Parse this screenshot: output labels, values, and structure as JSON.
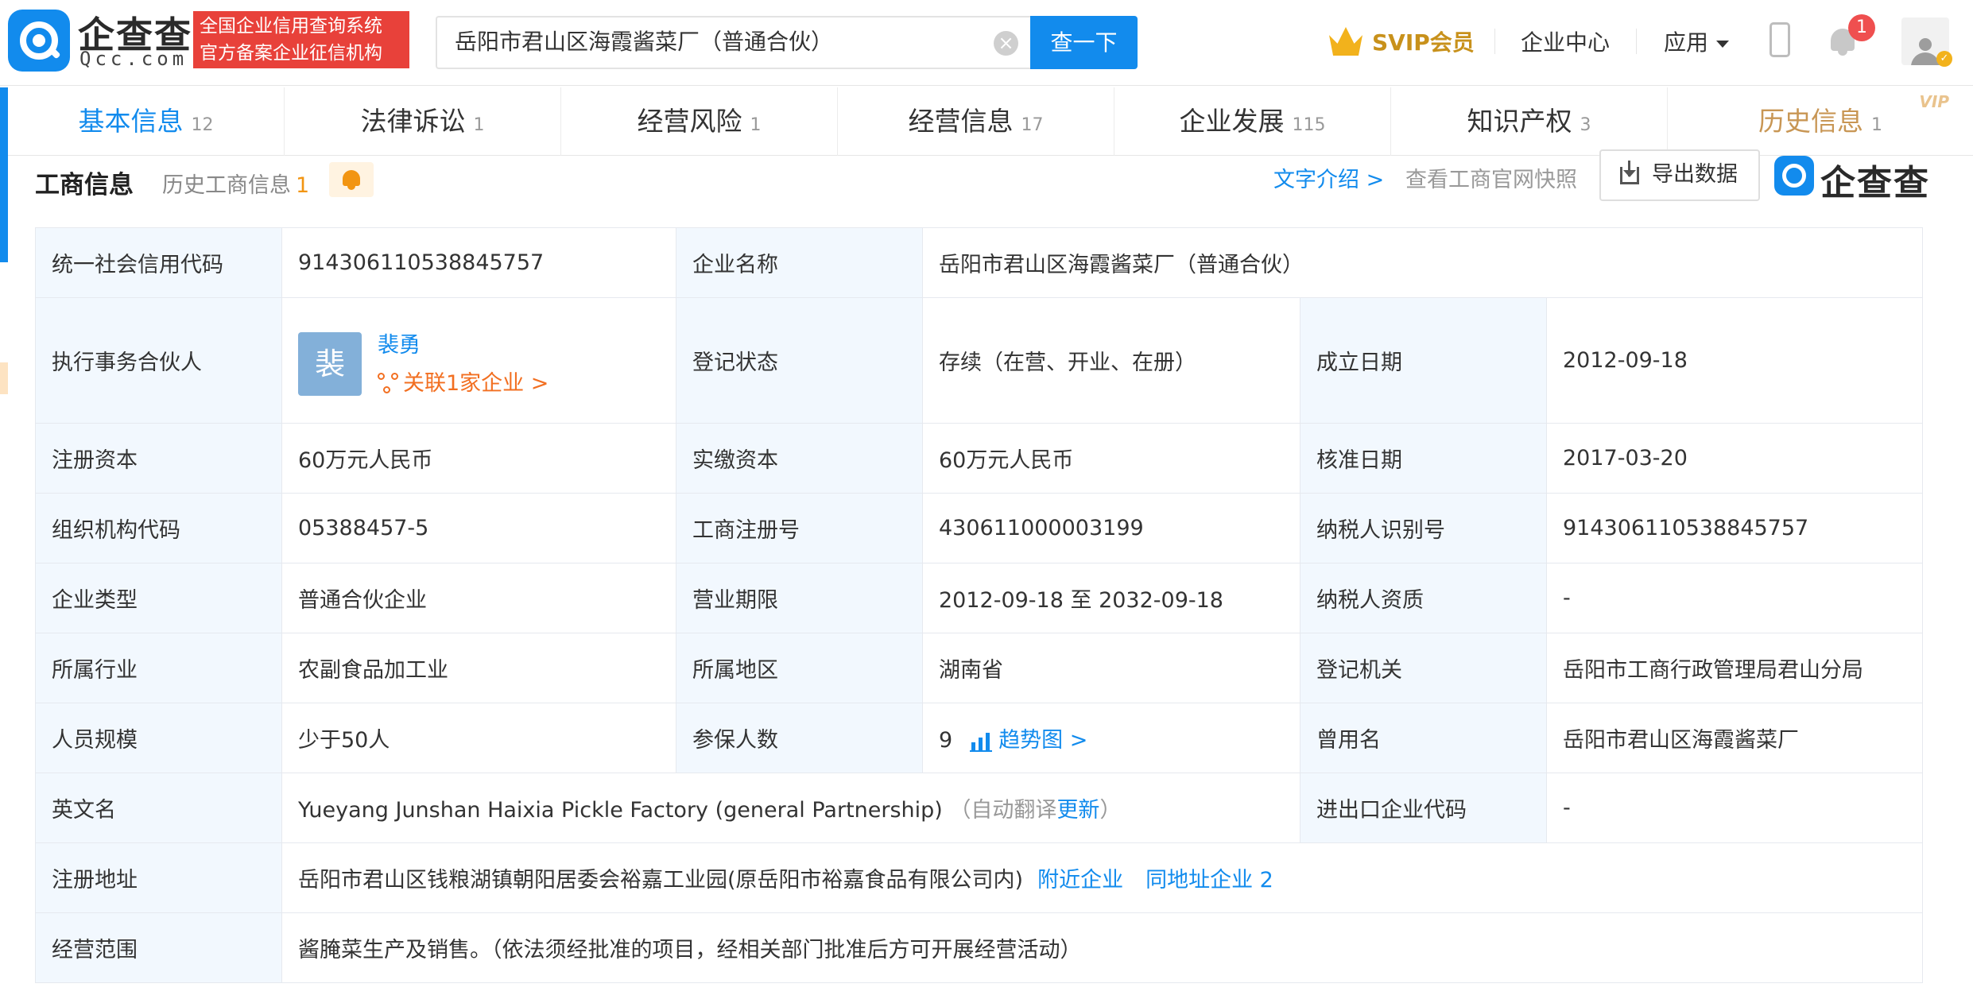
{
  "header": {
    "brand_cn": "企查查",
    "brand_en": "Qcc.com",
    "cert_line1": "全国企业信用查询系统",
    "cert_line2": "官方备案企业征信机构",
    "search_value": "岳阳市君山区海霞酱菜厂（普通合伙）",
    "search_button": "查一下",
    "svip_label": "SVIP会员",
    "enterprise_center": "企业中心",
    "apps": "应用",
    "notification_count": "1"
  },
  "tabs": [
    {
      "label": "基本信息",
      "count": "12"
    },
    {
      "label": "法律诉讼",
      "count": "1"
    },
    {
      "label": "经营风险",
      "count": "1"
    },
    {
      "label": "经营信息",
      "count": "17"
    },
    {
      "label": "企业发展",
      "count": "115"
    },
    {
      "label": "知识产权",
      "count": "3"
    },
    {
      "label": "历史信息",
      "count": "1",
      "tag": "VIP"
    }
  ],
  "section": {
    "title": "工商信息",
    "history_label": "历史工商信息",
    "history_count": "1",
    "text_intro": "文字介绍 >",
    "snapshot": "查看工商官网快照",
    "export": "导出数据",
    "watermark": "企查查"
  },
  "info": {
    "credit_code_label": "统一社会信用代码",
    "credit_code": "914306110538845757",
    "company_name_label": "企业名称",
    "company_name": "岳阳市君山区海霞酱菜厂（普通合伙）",
    "partner_label": "执行事务合伙人",
    "partner_avatar": "裴",
    "partner_name": "裴勇",
    "partner_link": "关联1家企业 >",
    "reg_status_label": "登记状态",
    "reg_status": "存续（在营、开业、在册）",
    "found_date_label": "成立日期",
    "found_date": "2012-09-18",
    "reg_capital_label": "注册资本",
    "reg_capital": "60万元人民币",
    "paid_capital_label": "实缴资本",
    "paid_capital": "60万元人民币",
    "approve_date_label": "核准日期",
    "approve_date": "2017-03-20",
    "org_code_label": "组织机构代码",
    "org_code": "05388457-5",
    "biz_reg_no_label": "工商注册号",
    "biz_reg_no": "430611000003199",
    "taxpayer_id_label": "纳税人识别号",
    "taxpayer_id": "914306110538845757",
    "company_type_label": "企业类型",
    "company_type": "普通合伙企业",
    "biz_term_label": "营业期限",
    "biz_term": "2012-09-18 至 2032-09-18",
    "taxpayer_qual_label": "纳税人资质",
    "taxpayer_qual": "-",
    "industry_label": "所属行业",
    "industry": "农副食品加工业",
    "region_label": "所属地区",
    "region": "湖南省",
    "reg_authority_label": "登记机关",
    "reg_authority": "岳阳市工商行政管理局君山分局",
    "staff_size_label": "人员规模",
    "staff_size": "少于50人",
    "insured_label": "参保人数",
    "insured": "9",
    "trend_link": "趋势图 >",
    "former_name_label": "曾用名",
    "former_name": "岳阳市君山区海霞酱菜厂",
    "english_name_label": "英文名",
    "english_name": "Yueyang Junshan Haixia Pickle Factory (general Partnership)",
    "auto_translate_prefix": "（自动翻译",
    "update_link": "更新",
    "auto_translate_suffix": "）",
    "ie_code_label": "进出口企业代码",
    "ie_code": "-",
    "address_label": "注册地址",
    "address": "岳阳市君山区钱粮湖镇朝阳居委会裕嘉工业园(原岳阳市裕嘉食品有限公司内)",
    "nearby_link": "附近企业",
    "same_address_link": "同地址企业 2",
    "scope_label": "经营范围",
    "scope": "酱腌菜生产及销售。（依法须经批准的项目，经相关部门批准后方可开展经营活动）"
  }
}
